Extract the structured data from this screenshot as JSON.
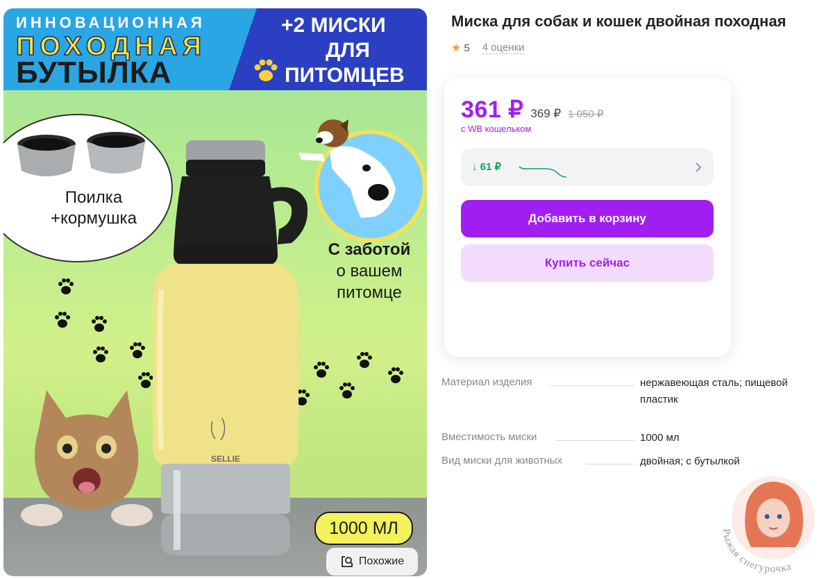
{
  "promo": {
    "line1": "ИННОВАЦИОННАЯ",
    "line2": "ПОХОДНАЯ",
    "line3": "БУТЫЛКА",
    "right1": "+2 МИСКИ",
    "right2": "ДЛЯ",
    "right3": "ПИТОМЦЕВ",
    "bubble_caption_1": "Поилка",
    "bubble_caption_2": "+кормушка",
    "care_1": "С заботой",
    "care_2": "о вашем",
    "care_3": "питомце",
    "brand": "SELLIE",
    "volume": "1000 МЛ"
  },
  "similar_button": "Похожие",
  "product": {
    "title": "Миска для собак и кошек двойная походная",
    "rating": "5",
    "reviews": "4 оценки"
  },
  "price": {
    "current": "361 ₽",
    "old": "369 ₽",
    "crossed": "1 050 ₽",
    "wallet_note": "с WB кошельком",
    "history_drop": "↓ 61 ₽"
  },
  "actions": {
    "add_to_cart": "Добавить в корзину",
    "buy_now": "Купить сейчас"
  },
  "specs": [
    {
      "label": "Материал изделия",
      "value": "нержавеющая сталь; пищевой пластик"
    },
    {
      "label": "Вместимость миски",
      "value": "1000 мл"
    },
    {
      "label": "Вид миски для животных",
      "value": "двойная; с бутылкой"
    }
  ],
  "watermark": "Рыжая снегурочка",
  "colors": {
    "accent": "#a11ef0",
    "accent_light": "#f3dcfb",
    "price_drop": "#12a35b",
    "star": "#f29a2e"
  }
}
